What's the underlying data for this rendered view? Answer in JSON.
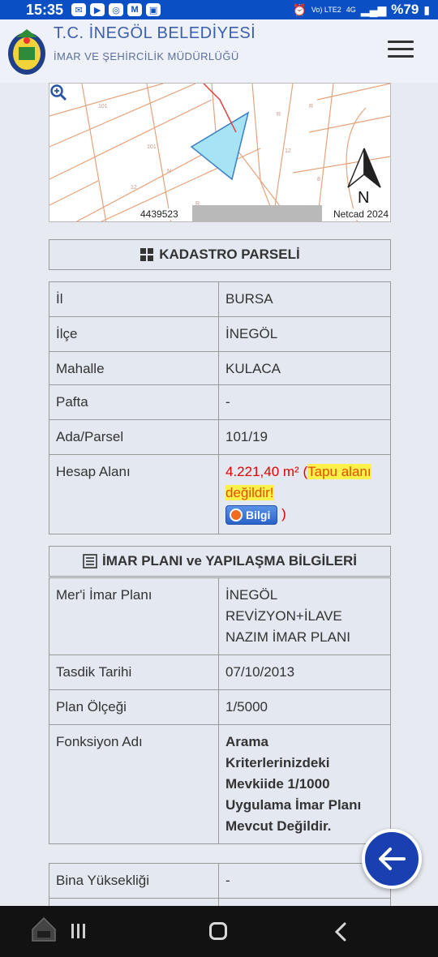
{
  "status_bar": {
    "time": "15:35",
    "icons": [
      "messenger-icon",
      "youtube-icon",
      "instagram-icon",
      "gmail-icon",
      "gallery-icon"
    ],
    "network": "Vo) LTE2",
    "network_gen": "4G",
    "battery": "%79"
  },
  "header": {
    "title": "T.C. İNEGÖL BELEDİYESİ",
    "subtitle": "İMAR VE ŞEHİRCİLİK MÜDÜRLÜĞÜ"
  },
  "map": {
    "coords": "4439523",
    "credit": "Netcad 2024",
    "north_label": "N",
    "parcel_color": "#a6e3f5"
  },
  "kadastro": {
    "title": "KADASTRO PARSELİ",
    "rows1": [
      {
        "key": "İl",
        "value": "BURSA"
      },
      {
        "key": "İlçe",
        "value": "İNEGÖL"
      },
      {
        "key": "Mahalle",
        "value": "KULACA"
      }
    ],
    "pafta_key": "Pafta",
    "pafta_value": "-",
    "ada_key": "Ada/Parsel",
    "ada_value": "101/19",
    "hesap_key": "Hesap Alanı",
    "hesap_value": "4.221,40 m²",
    "hesap_open": " (",
    "hesap_note": "Tapu alanı değildir!",
    "info_button": "Bilgi",
    "hesap_close": " )"
  },
  "imar": {
    "title": "İMAR PLANI ve YAPILAŞMA BİLGİLERİ",
    "meri_key": "Mer'i İmar Planı",
    "meri_value": [
      "İNEGÖL",
      "REVİZYON+İLAVE",
      "NAZIM İMAR PLANI"
    ],
    "tasdik_key": "Tasdik Tarihi",
    "tasdik_value": "07/10/2013",
    "olcek_key": "Plan Ölçeği",
    "olcek_value": "1/5000",
    "fonksiyon_key": "Fonksiyon Adı",
    "fonksiyon_value": [
      "Arama",
      "Kriterlerinizdeki",
      "Mevkiide 1/1000",
      "Uygulama İmar Planı",
      "Mevcut Değildir."
    ]
  },
  "bina": {
    "key": "Bina Yüksekliği",
    "value": "-"
  },
  "colors": {
    "status_bar": "#0a4fc4",
    "accent": "#1a3fb0",
    "warning": "#e00000",
    "highlight": "#fff04a"
  }
}
